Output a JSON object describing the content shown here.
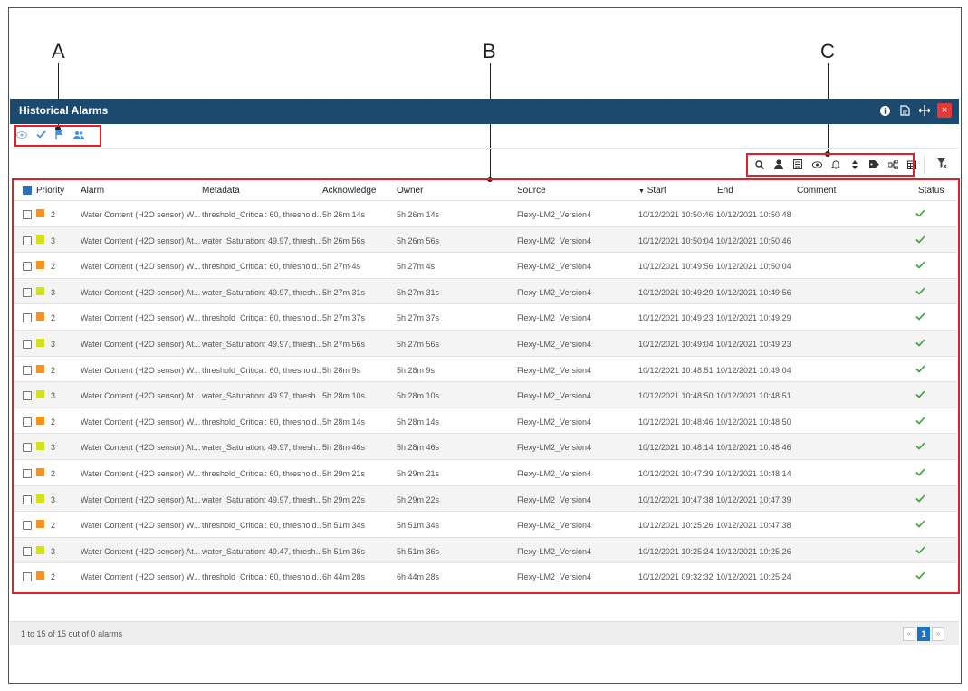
{
  "callouts": {
    "a": "A",
    "b": "B",
    "c": "C"
  },
  "window": {
    "title": "Historical Alarms",
    "icons": [
      "info-icon",
      "pdf-export-icon",
      "resize-icon",
      "close-icon"
    ],
    "close_glyph": "×"
  },
  "toolbar_a": {
    "icons": [
      "eye-icon",
      "check-icon",
      "flag-icon",
      "users-icon"
    ]
  },
  "toolbar_c": {
    "icons": [
      "search-icon",
      "user-icon",
      "list-icon",
      "eye-icon",
      "bell-icon",
      "sort-icon",
      "tag-icon",
      "hierarchy-icon",
      "calendar-icon"
    ]
  },
  "table": {
    "headers": {
      "priority": "Priority",
      "alarm": "Alarm",
      "metadata": "Metadata",
      "acknowledge": "Acknowledge",
      "owner": "Owner",
      "source": "Source",
      "start": "Start",
      "end": "End",
      "comment": "Comment",
      "status": "Status"
    },
    "rows": [
      {
        "priority": "2",
        "alarm": "Water Content (H2O sensor) W...",
        "metadata": "threshold_Critical: 60, threshold...",
        "acknowledge": "5h 26m 14s",
        "owner": "5h 26m 14s",
        "source": "Flexy-LM2_Version4",
        "start": "10/12/2021 10:50:46",
        "end": "10/12/2021 10:50:48",
        "comment": ""
      },
      {
        "priority": "3",
        "alarm": "Water Content (H2O sensor) At...",
        "metadata": "water_Saturation: 49.97, thresh...",
        "acknowledge": "5h 26m 56s",
        "owner": "5h 26m 56s",
        "source": "Flexy-LM2_Version4",
        "start": "10/12/2021 10:50:04",
        "end": "10/12/2021 10:50:46",
        "comment": ""
      },
      {
        "priority": "2",
        "alarm": "Water Content (H2O sensor) W...",
        "metadata": "threshold_Critical: 60, threshold...",
        "acknowledge": "5h 27m 4s",
        "owner": "5h 27m 4s",
        "source": "Flexy-LM2_Version4",
        "start": "10/12/2021 10:49:56",
        "end": "10/12/2021 10:50:04",
        "comment": ""
      },
      {
        "priority": "3",
        "alarm": "Water Content (H2O sensor) At...",
        "metadata": "water_Saturation: 49.97, thresh...",
        "acknowledge": "5h 27m 31s",
        "owner": "5h 27m 31s",
        "source": "Flexy-LM2_Version4",
        "start": "10/12/2021 10:49:29",
        "end": "10/12/2021 10:49:56",
        "comment": ""
      },
      {
        "priority": "2",
        "alarm": "Water Content (H2O sensor) W...",
        "metadata": "threshold_Critical: 60, threshold...",
        "acknowledge": "5h 27m 37s",
        "owner": "5h 27m 37s",
        "source": "Flexy-LM2_Version4",
        "start": "10/12/2021 10:49:23",
        "end": "10/12/2021 10:49:29",
        "comment": ""
      },
      {
        "priority": "3",
        "alarm": "Water Content (H2O sensor) At...",
        "metadata": "water_Saturation: 49.97, thresh...",
        "acknowledge": "5h 27m 56s",
        "owner": "5h 27m 56s",
        "source": "Flexy-LM2_Version4",
        "start": "10/12/2021 10:49:04",
        "end": "10/12/2021 10:49:23",
        "comment": ""
      },
      {
        "priority": "2",
        "alarm": "Water Content (H2O sensor) W...",
        "metadata": "threshold_Critical: 60, threshold...",
        "acknowledge": "5h 28m 9s",
        "owner": "5h 28m 9s",
        "source": "Flexy-LM2_Version4",
        "start": "10/12/2021 10:48:51",
        "end": "10/12/2021 10:49:04",
        "comment": ""
      },
      {
        "priority": "3",
        "alarm": "Water Content (H2O sensor) At...",
        "metadata": "water_Saturation: 49.97, thresh...",
        "acknowledge": "5h 28m 10s",
        "owner": "5h 28m 10s",
        "source": "Flexy-LM2_Version4",
        "start": "10/12/2021 10:48:50",
        "end": "10/12/2021 10:48:51",
        "comment": ""
      },
      {
        "priority": "2",
        "alarm": "Water Content (H2O sensor) W...",
        "metadata": "threshold_Critical: 60, threshold...",
        "acknowledge": "5h 28m 14s",
        "owner": "5h 28m 14s",
        "source": "Flexy-LM2_Version4",
        "start": "10/12/2021 10:48:46",
        "end": "10/12/2021 10:48:50",
        "comment": ""
      },
      {
        "priority": "3",
        "alarm": "Water Content (H2O sensor) At...",
        "metadata": "water_Saturation: 49.97, thresh...",
        "acknowledge": "5h 28m 46s",
        "owner": "5h 28m 46s",
        "source": "Flexy-LM2_Version4",
        "start": "10/12/2021 10:48:14",
        "end": "10/12/2021 10:48:46",
        "comment": ""
      },
      {
        "priority": "2",
        "alarm": "Water Content (H2O sensor) W...",
        "metadata": "threshold_Critical: 60, threshold...",
        "acknowledge": "5h 29m 21s",
        "owner": "5h 29m 21s",
        "source": "Flexy-LM2_Version4",
        "start": "10/12/2021 10:47:39",
        "end": "10/12/2021 10:48:14",
        "comment": ""
      },
      {
        "priority": "3",
        "alarm": "Water Content (H2O sensor) At...",
        "metadata": "water_Saturation: 49.97, thresh...",
        "acknowledge": "5h 29m 22s",
        "owner": "5h 29m 22s",
        "source": "Flexy-LM2_Version4",
        "start": "10/12/2021 10:47:38",
        "end": "10/12/2021 10:47:39",
        "comment": ""
      },
      {
        "priority": "2",
        "alarm": "Water Content (H2O sensor) W...",
        "metadata": "threshold_Critical: 60, threshold...",
        "acknowledge": "5h 51m 34s",
        "owner": "5h 51m 34s",
        "source": "Flexy-LM2_Version4",
        "start": "10/12/2021 10:25:26",
        "end": "10/12/2021 10:47:38",
        "comment": ""
      },
      {
        "priority": "3",
        "alarm": "Water Content (H2O sensor) At...",
        "metadata": "water_Saturation: 49.47, thresh...",
        "acknowledge": "5h 51m 36s",
        "owner": "5h 51m 36s",
        "source": "Flexy-LM2_Version4",
        "start": "10/12/2021 10:25:24",
        "end": "10/12/2021 10:25:26",
        "comment": ""
      },
      {
        "priority": "2",
        "alarm": "Water Content (H2O sensor) W...",
        "metadata": "threshold_Critical: 60, threshold...",
        "acknowledge": "6h 44m 28s",
        "owner": "6h 44m 28s",
        "source": "Flexy-LM2_Version4",
        "start": "10/12/2021 09:32:32",
        "end": "10/12/2021 10:25:24",
        "comment": ""
      }
    ]
  },
  "colors": {
    "header_bg": "#1c4a6e",
    "priority_2": "#f39323",
    "priority_3": "#d4e01c",
    "status_ok": "#3aa33a",
    "callout_box": "#e0202a"
  },
  "footer": {
    "summary": "1 to 15 of 15 out of 0 alarms",
    "pager": {
      "prev": "«",
      "page": "1",
      "next": "»"
    }
  }
}
